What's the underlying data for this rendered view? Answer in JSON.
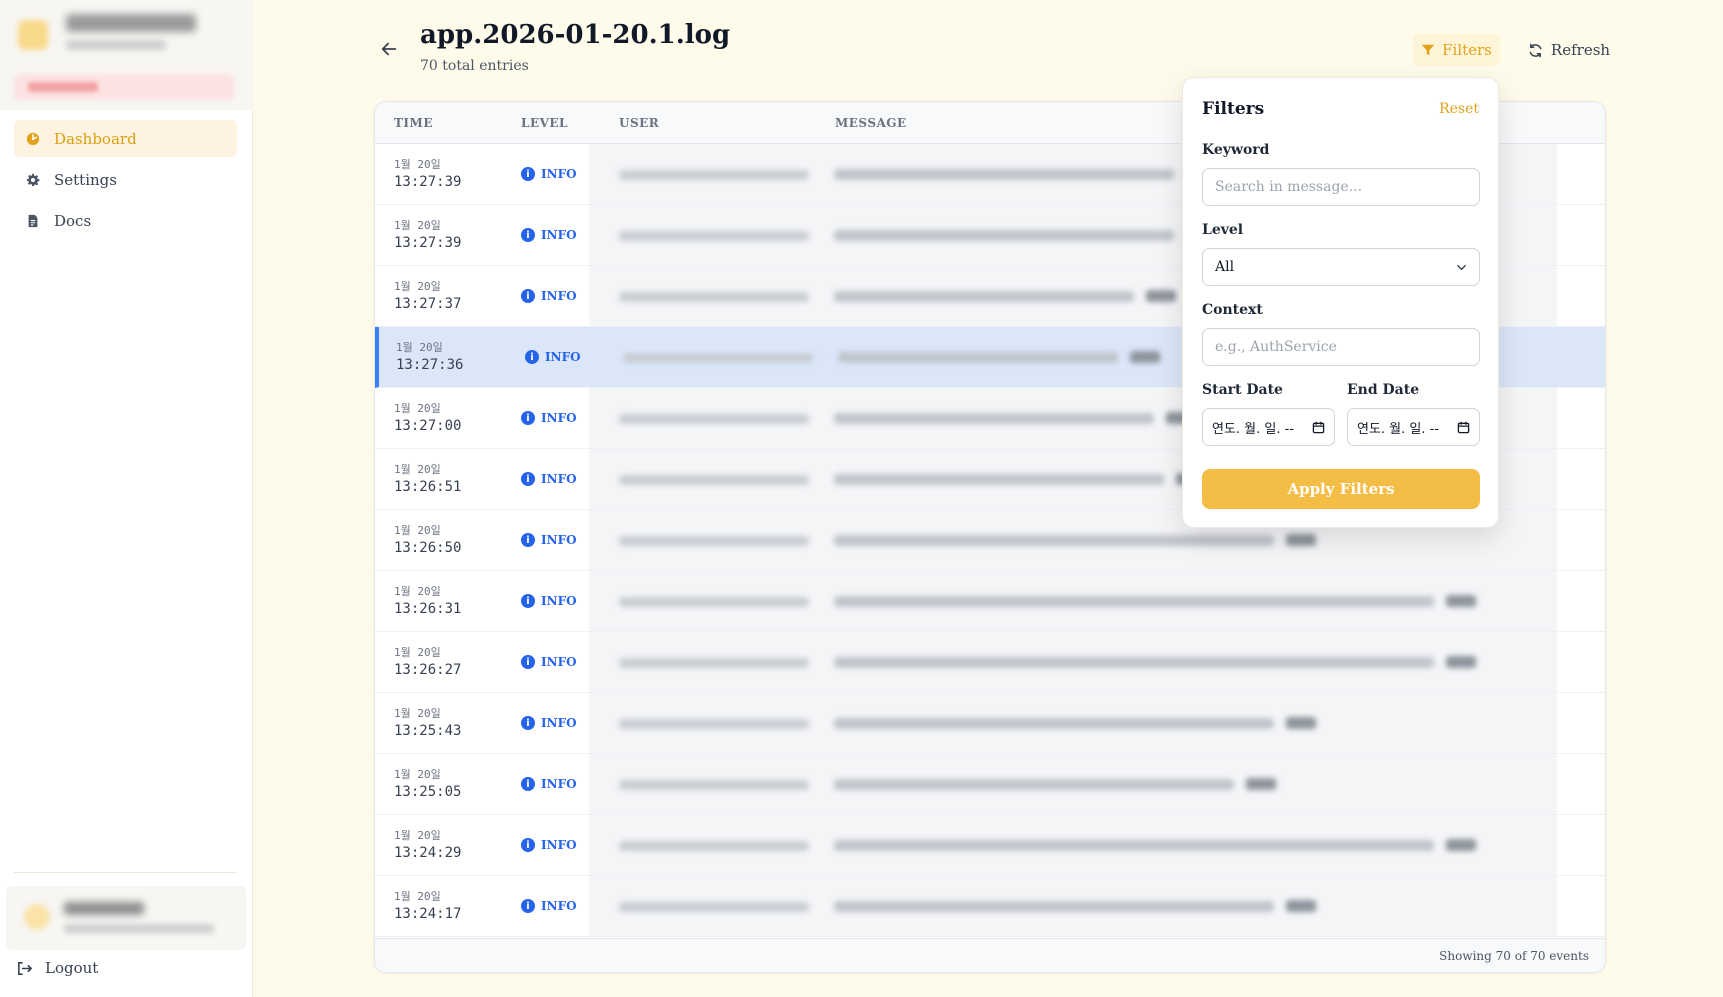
{
  "sidebar": {
    "nav": [
      {
        "label": "Dashboard",
        "icon": "dashboard-icon",
        "active": true
      },
      {
        "label": "Settings",
        "icon": "gear-icon",
        "active": false
      },
      {
        "label": "Docs",
        "icon": "document-icon",
        "active": false
      }
    ],
    "logout_label": "Logout"
  },
  "header": {
    "title": "app.2026-01-20.1.log",
    "subtitle": "70 total entries",
    "filters_label": "Filters",
    "refresh_label": "Refresh"
  },
  "table": {
    "columns": {
      "time": "TIME",
      "level": "LEVEL",
      "user": "USER",
      "message": "MESSAGE"
    },
    "rows": [
      {
        "date": "1월 20일",
        "time": "13:27:39",
        "level": "INFO"
      },
      {
        "date": "1월 20일",
        "time": "13:27:39",
        "level": "INFO"
      },
      {
        "date": "1월 20일",
        "time": "13:27:37",
        "level": "INFO"
      },
      {
        "date": "1월 20일",
        "time": "13:27:36",
        "level": "INFO",
        "selected": true
      },
      {
        "date": "1월 20일",
        "time": "13:27:00",
        "level": "INFO"
      },
      {
        "date": "1월 20일",
        "time": "13:26:51",
        "level": "INFO"
      },
      {
        "date": "1월 20일",
        "time": "13:26:50",
        "level": "INFO"
      },
      {
        "date": "1월 20일",
        "time": "13:26:31",
        "level": "INFO"
      },
      {
        "date": "1월 20일",
        "time": "13:26:27",
        "level": "INFO"
      },
      {
        "date": "1월 20일",
        "time": "13:25:43",
        "level": "INFO"
      },
      {
        "date": "1월 20일",
        "time": "13:25:05",
        "level": "INFO"
      },
      {
        "date": "1월 20일",
        "time": "13:24:29",
        "level": "INFO"
      },
      {
        "date": "1월 20일",
        "time": "13:24:17",
        "level": "INFO"
      }
    ],
    "footer": "Showing 70 of 70 events"
  },
  "filters": {
    "title": "Filters",
    "reset_label": "Reset",
    "keyword_label": "Keyword",
    "keyword_placeholder": "Search in message...",
    "level_label": "Level",
    "level_value": "All",
    "context_label": "Context",
    "context_placeholder": "e.g., AuthService",
    "start_label": "Start Date",
    "end_label": "End Date",
    "start_value": "연도. 월. 일. --",
    "end_value": "연도. 월. 일. --",
    "apply_label": "Apply Filters"
  },
  "colors": {
    "accent": "#f4bd45",
    "info": "#2563eb",
    "selected_row": "#dbe7f9"
  }
}
